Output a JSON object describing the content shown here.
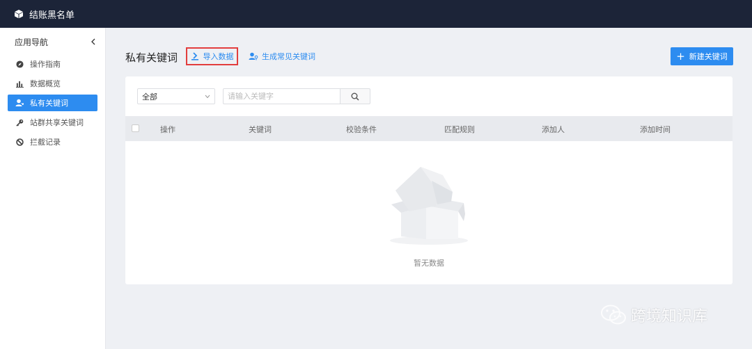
{
  "app": {
    "title": "结账黑名单"
  },
  "sidebar": {
    "header": "应用导航",
    "items": [
      {
        "label": "操作指南",
        "icon": "compass-icon",
        "active": false
      },
      {
        "label": "数据概览",
        "icon": "bar-chart-icon",
        "active": false
      },
      {
        "label": "私有关键词",
        "icon": "user-key-icon",
        "active": true
      },
      {
        "label": "站群共享关键词",
        "icon": "key-icon",
        "active": false
      },
      {
        "label": "拦截记录",
        "icon": "block-icon",
        "active": false
      }
    ]
  },
  "main": {
    "title": "私有关键词",
    "import_label": "导入数据",
    "generate_label": "生成常见关键词",
    "new_label": "新建关键词",
    "filter": {
      "selected": "全部"
    },
    "search": {
      "placeholder": "请输入关键字",
      "value": ""
    },
    "table": {
      "columns": [
        "操作",
        "关键词",
        "校验条件",
        "匹配规则",
        "添加人",
        "添加时间"
      ],
      "rows": []
    },
    "empty_text": "暂无数据"
  },
  "watermark": {
    "text": "跨境知识库"
  },
  "colors": {
    "topbar": "#1c2438",
    "accent": "#2d8cf0",
    "highlight_border": "#e23d3d",
    "background": "#eef0f4"
  }
}
